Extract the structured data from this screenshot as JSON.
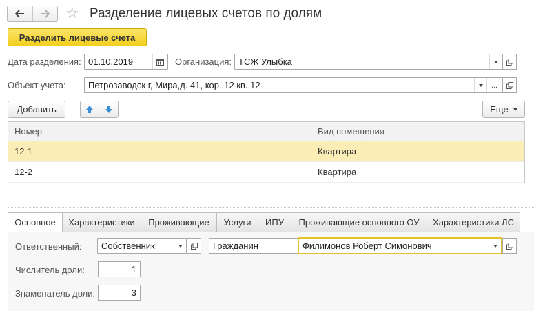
{
  "header": {
    "back_icon": "arrow-left-icon",
    "forward_icon": "arrow-right-icon",
    "favorite_icon": "star-icon",
    "title": "Разделение лицевых счетов по долям"
  },
  "toolbar": {
    "split_label": "Разделить лицевые счета"
  },
  "form": {
    "date_label": "Дата разделения:",
    "date_value": "01.10.2019",
    "org_label": "Организация:",
    "org_value": "ТСЖ Улыбка",
    "object_label": "Объект учета:",
    "object_value": "Петрозаводск г, Мира,д. 41, кор. 12 кв. 12",
    "object_dots": "..."
  },
  "table_toolbar": {
    "add_label": "Добавить",
    "more_label": "Еще"
  },
  "table": {
    "columns": [
      "Номер",
      "Вид помещения"
    ],
    "rows": [
      {
        "number": "12-1",
        "type": "Квартира",
        "selected": true
      },
      {
        "number": "12-2",
        "type": "Квартира",
        "selected": false
      }
    ]
  },
  "tabs": [
    {
      "label": "Основное",
      "active": true
    },
    {
      "label": "Характеристики",
      "active": false
    },
    {
      "label": "Проживающие",
      "active": false
    },
    {
      "label": "Услуги",
      "active": false
    },
    {
      "label": "ИПУ",
      "active": false
    },
    {
      "label": "Проживающие основного ОУ",
      "active": false
    },
    {
      "label": "Характеристики ЛС",
      "active": false
    }
  ],
  "details": {
    "responsible_label": "Ответственный:",
    "responsible_kind": "Собственник",
    "person_type": "Гражданин",
    "person_name": "Филимонов Роберт Симонович",
    "numerator_label": "Числитель доли:",
    "numerator_value": "1",
    "denominator_label": "Знаменатель доли:",
    "denominator_value": "3"
  },
  "colors": {
    "primary_button": "#f5d327",
    "selected_row": "#fbedb6",
    "focus_border": "#e6c229"
  }
}
